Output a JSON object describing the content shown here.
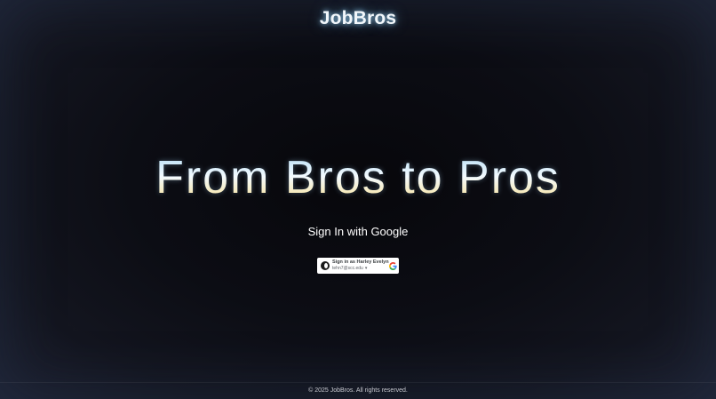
{
  "header": {
    "brand": "JobBros"
  },
  "hero": {
    "title": "From Bros to Pros"
  },
  "signin": {
    "heading": "Sign In with Google",
    "button": {
      "account_label": "Sign in as Harley Evelyn",
      "email": "tehn7@scc.edu"
    }
  },
  "footer": {
    "copyright": "© 2025 JobBros. All rights reserved."
  },
  "colors": {
    "background": "#0c0d14",
    "brand_glow": "#96cdf0",
    "title_top": "#a9d6f2",
    "title_bottom": "#e8c98e",
    "button_bg": "#ffffff"
  }
}
